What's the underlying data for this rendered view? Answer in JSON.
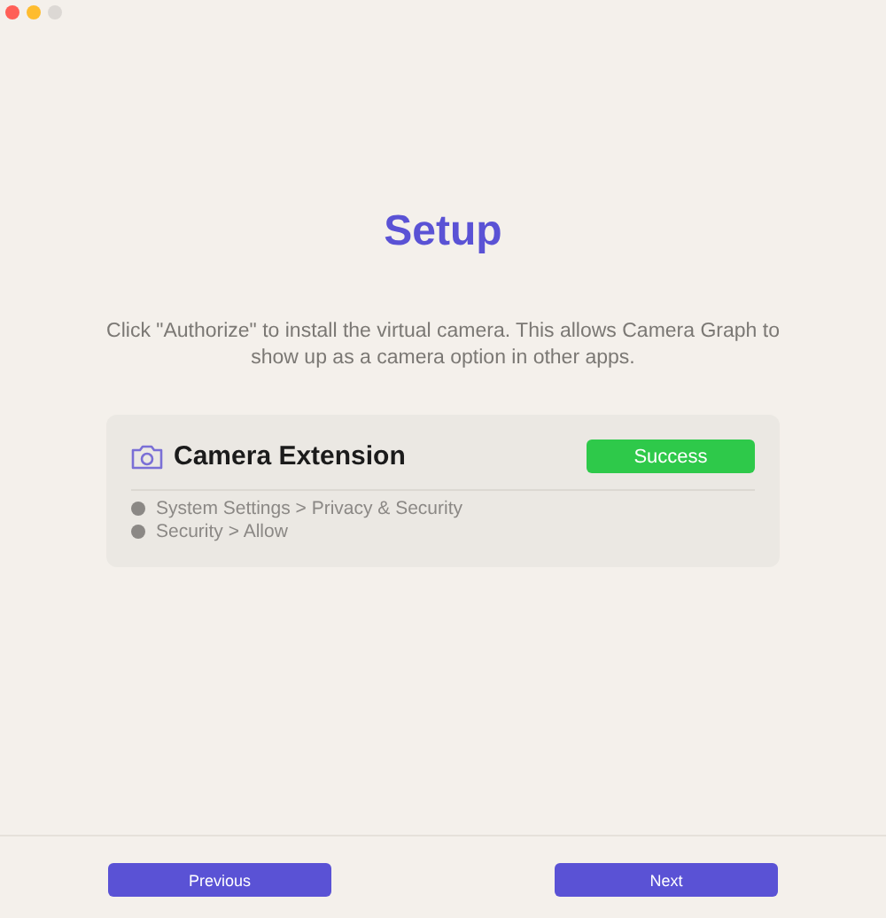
{
  "title": "Setup",
  "description": "Click \"Authorize\" to install the virtual camera. This allows Camera Graph to show up as a camera option in other apps.",
  "extension": {
    "name": "Camera Extension",
    "status": {
      "label": "Success",
      "kind": "success"
    },
    "steps": [
      "System Settings > Privacy & Security",
      "Security > Allow"
    ]
  },
  "buttons": [
    {
      "label": "Previous"
    },
    {
      "label": "Next"
    }
  ]
}
